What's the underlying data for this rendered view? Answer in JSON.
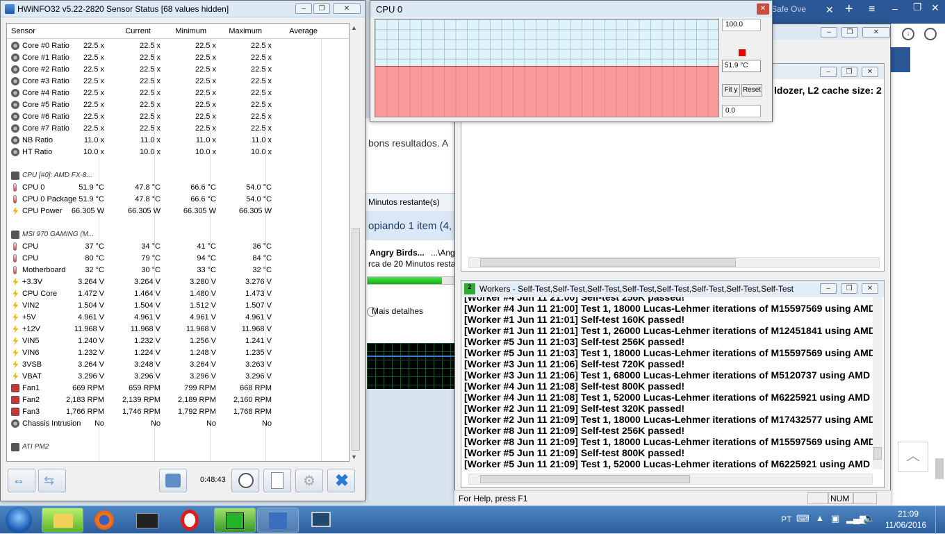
{
  "hwinfo": {
    "title": "HWiNFO32 v5.22-2820 Sensor Status [68 values hidden]",
    "columns": [
      "Sensor",
      "Current",
      "Minimum",
      "Maximum",
      "Average"
    ],
    "rows": [
      {
        "icon": "gear",
        "label": "Core #0 Ratio",
        "cur": "22.5 x",
        "min": "22.5 x",
        "max": "22.5 x",
        "avg": "22.5 x"
      },
      {
        "icon": "gear",
        "label": "Core #1 Ratio",
        "cur": "22.5 x",
        "min": "22.5 x",
        "max": "22.5 x",
        "avg": "22.5 x"
      },
      {
        "icon": "gear",
        "label": "Core #2 Ratio",
        "cur": "22.5 x",
        "min": "22.5 x",
        "max": "22.5 x",
        "avg": "22.5 x"
      },
      {
        "icon": "gear",
        "label": "Core #3 Ratio",
        "cur": "22.5 x",
        "min": "22.5 x",
        "max": "22.5 x",
        "avg": "22.5 x"
      },
      {
        "icon": "gear",
        "label": "Core #4 Ratio",
        "cur": "22.5 x",
        "min": "22.5 x",
        "max": "22.5 x",
        "avg": "22.5 x"
      },
      {
        "icon": "gear",
        "label": "Core #5 Ratio",
        "cur": "22.5 x",
        "min": "22.5 x",
        "max": "22.5 x",
        "avg": "22.5 x"
      },
      {
        "icon": "gear",
        "label": "Core #6 Ratio",
        "cur": "22.5 x",
        "min": "22.5 x",
        "max": "22.5 x",
        "avg": "22.5 x"
      },
      {
        "icon": "gear",
        "label": "Core #7 Ratio",
        "cur": "22.5 x",
        "min": "22.5 x",
        "max": "22.5 x",
        "avg": "22.5 x"
      },
      {
        "icon": "gear",
        "label": "NB Ratio",
        "cur": "11.0 x",
        "min": "11.0 x",
        "max": "11.0 x",
        "avg": "11.0 x"
      },
      {
        "icon": "gear",
        "label": "HT Ratio",
        "cur": "10.0 x",
        "min": "10.0 x",
        "max": "10.0 x",
        "avg": "10.0 x"
      },
      {
        "icon": "none",
        "label": "",
        "cur": "",
        "min": "",
        "max": "",
        "avg": ""
      },
      {
        "icon": "chip",
        "label": "CPU [#0]: AMD FX-8...",
        "group": true,
        "cur": "",
        "min": "",
        "max": "",
        "avg": ""
      },
      {
        "icon": "therm",
        "label": "CPU 0",
        "cur": "51.9 °C",
        "min": "47.8 °C",
        "max": "66.6 °C",
        "avg": "54.0 °C"
      },
      {
        "icon": "therm",
        "label": "CPU 0 Package",
        "cur": "51.9 °C",
        "min": "47.8 °C",
        "max": "66.6 °C",
        "avg": "54.0 °C"
      },
      {
        "icon": "bolt",
        "label": "CPU Power",
        "cur": "66.305 W",
        "min": "66.305 W",
        "max": "66.305 W",
        "avg": "66.305 W"
      },
      {
        "icon": "none",
        "label": "",
        "cur": "",
        "min": "",
        "max": "",
        "avg": ""
      },
      {
        "icon": "chip",
        "label": "MSI 970 GAMING (M...",
        "group": true,
        "cur": "",
        "min": "",
        "max": "",
        "avg": ""
      },
      {
        "icon": "therm",
        "label": "CPU",
        "cur": "37 °C",
        "min": "34 °C",
        "max": "41 °C",
        "avg": "36 °C"
      },
      {
        "icon": "therm",
        "label": "CPU",
        "cur": "80 °C",
        "min": "79 °C",
        "max": "94 °C",
        "avg": "84 °C"
      },
      {
        "icon": "therm",
        "label": "Motherboard",
        "cur": "32 °C",
        "min": "30 °C",
        "max": "33 °C",
        "avg": "32 °C"
      },
      {
        "icon": "bolt",
        "label": "+3.3V",
        "cur": "3.264 V",
        "min": "3.264 V",
        "max": "3.280 V",
        "avg": "3.276 V"
      },
      {
        "icon": "bolt",
        "label": "CPU Core",
        "cur": "1.472 V",
        "min": "1.464 V",
        "max": "1.480 V",
        "avg": "1.473 V"
      },
      {
        "icon": "bolt",
        "label": "VIN2",
        "cur": "1.504 V",
        "min": "1.504 V",
        "max": "1.512 V",
        "avg": "1.507 V"
      },
      {
        "icon": "bolt",
        "label": "+5V",
        "cur": "4.961 V",
        "min": "4.961 V",
        "max": "4.961 V",
        "avg": "4.961 V"
      },
      {
        "icon": "bolt",
        "label": "+12V",
        "cur": "11.968 V",
        "min": "11.968 V",
        "max": "11.968 V",
        "avg": "11.968 V"
      },
      {
        "icon": "bolt",
        "label": "VIN5",
        "cur": "1.240 V",
        "min": "1.232 V",
        "max": "1.256 V",
        "avg": "1.241 V"
      },
      {
        "icon": "bolt",
        "label": "VIN6",
        "cur": "1.232 V",
        "min": "1.224 V",
        "max": "1.248 V",
        "avg": "1.235 V"
      },
      {
        "icon": "bolt",
        "label": "3VSB",
        "cur": "3.264 V",
        "min": "3.248 V",
        "max": "3.264 V",
        "avg": "3.263 V"
      },
      {
        "icon": "bolt",
        "label": "VBAT",
        "cur": "3.296 V",
        "min": "3.296 V",
        "max": "3.296 V",
        "avg": "3.296 V"
      },
      {
        "icon": "fan",
        "label": "Fan1",
        "cur": "669 RPM",
        "min": "659 RPM",
        "max": "799 RPM",
        "avg": "668 RPM"
      },
      {
        "icon": "fan",
        "label": "Fan2",
        "cur": "2,183 RPM",
        "min": "2,139 RPM",
        "max": "2,189 RPM",
        "avg": "2,160 RPM"
      },
      {
        "icon": "fan",
        "label": "Fan3",
        "cur": "1,766 RPM",
        "min": "1,746 RPM",
        "max": "1,792 RPM",
        "avg": "1,768 RPM"
      },
      {
        "icon": "gear",
        "label": "Chassis Intrusion",
        "cur": "No",
        "min": "No",
        "max": "No",
        "avg": "No"
      },
      {
        "icon": "none",
        "label": "",
        "cur": "",
        "min": "",
        "max": "",
        "avg": ""
      },
      {
        "icon": "chip",
        "label": "ATI PM2",
        "group": true,
        "cur": "",
        "min": "",
        "max": "",
        "avg": ""
      }
    ],
    "timer": "0:48:43"
  },
  "graph": {
    "title": "CPU 0",
    "max_label": "100.0",
    "current_value": "51.9 °C",
    "min_label": "0.0",
    "fit_label": "Fit y",
    "reset_label": "Reset",
    "fill_level": 0.519
  },
  "copy_dialog": {
    "text1": "bons resultados. A",
    "remaining": "Minutos restante(s)",
    "copying": "opiando 1 item (4,",
    "item_name": "Angry Birds...",
    "item_path": "...\\Angr",
    "item_sub": "rca de 20 Minutos resta",
    "progress": 0.85,
    "more_details": "Mais detalhes"
  },
  "prime_main": {
    "text": "ldozer, L2 cache size: 2"
  },
  "workers": {
    "title": "Workers - Self-Test,Self-Test,Self-Test,Self-Test,Self-Test,Self-Test,Self-Test,Self-Test",
    "lines": [
      "[Worker #4 Jun 11 21:00] Self-test 256K passed!",
      "[Worker #4 Jun 11 21:00] Test 1, 18000 Lucas-Lehmer iterations of M15597569 using AMD",
      "[Worker #1 Jun 11 21:01] Self-test 160K passed!",
      "[Worker #1 Jun 11 21:01] Test 1, 26000 Lucas-Lehmer iterations of M12451841 using AMD",
      "[Worker #5 Jun 11 21:03] Self-test 256K passed!",
      "[Worker #5 Jun 11 21:03] Test 1, 18000 Lucas-Lehmer iterations of M15597569 using AMD",
      "[Worker #3 Jun 11 21:06] Self-test 720K passed!",
      "[Worker #3 Jun 11 21:06] Test 1, 68000 Lucas-Lehmer iterations of M5120737 using AMD",
      "[Worker #4 Jun 11 21:08] Self-test 800K passed!",
      "[Worker #4 Jun 11 21:08] Test 1, 52000 Lucas-Lehmer iterations of M6225921 using AMD",
      "[Worker #2 Jun 11 21:09] Self-test 320K passed!",
      "[Worker #2 Jun 11 21:09] Test 1, 18000 Lucas-Lehmer iterations of M17432577 using AMD",
      "[Worker #8 Jun 11 21:09] Self-test 256K passed!",
      "[Worker #8 Jun 11 21:09] Test 1, 18000 Lucas-Lehmer iterations of M15597569 using AMD",
      "[Worker #5 Jun 11 21:09] Self-test 800K passed!",
      "[Worker #5 Jun 11 21:09] Test 1, 52000 Lucas-Lehmer iterations of M6225921 using AMD"
    ]
  },
  "status_bar": {
    "help": "For Help, press F1",
    "num": "NUM"
  },
  "browser": {
    "tab_text": "Safe Ove"
  },
  "taskbar": {
    "lang": "PT",
    "time": "21:09",
    "date": "11/06/2016"
  }
}
